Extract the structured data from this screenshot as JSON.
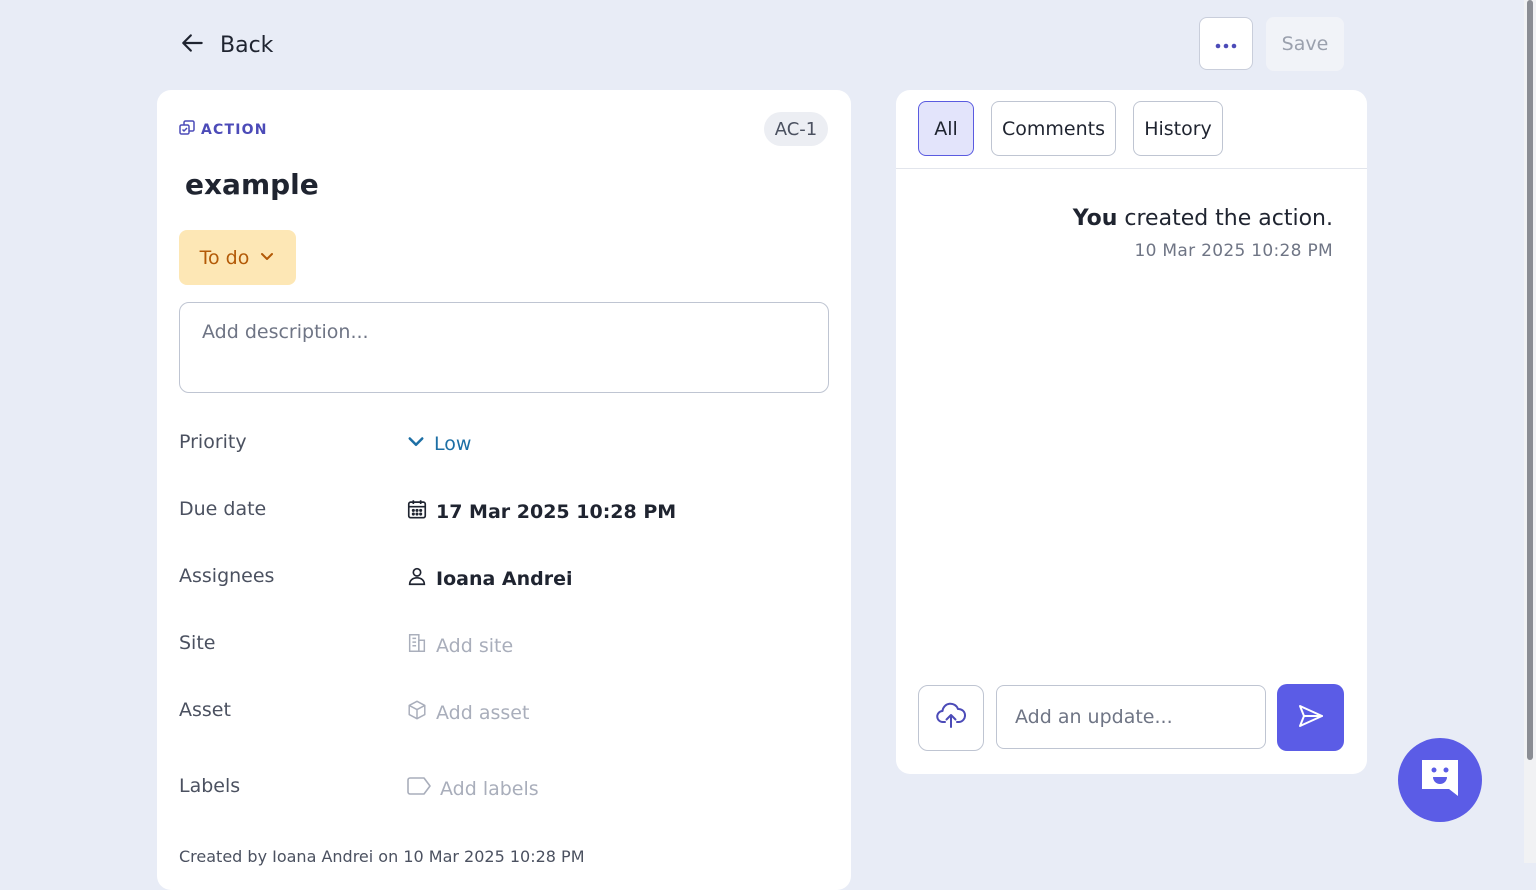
{
  "header": {
    "back_label": "Back",
    "more_label": "···",
    "save_label": "Save"
  },
  "action": {
    "type_label": "ACTION",
    "id": "AC-1",
    "title": "example",
    "status": "To do",
    "description_placeholder": "Add description...",
    "fields": {
      "priority": {
        "label": "Priority",
        "value": "Low"
      },
      "due_date": {
        "label": "Due date",
        "value": "17 Mar 2025 10:28 PM"
      },
      "assignees": {
        "label": "Assignees",
        "value": "Ioana Andrei"
      },
      "site": {
        "label": "Site",
        "value": "Add site"
      },
      "asset": {
        "label": "Asset",
        "value": "Add asset"
      },
      "labels": {
        "label": "Labels",
        "value": "Add labels"
      }
    },
    "created_note": "Created by Ioana Andrei on 10 Mar 2025 10:28 PM"
  },
  "activity_panel": {
    "tabs": [
      {
        "label": "All",
        "active": true
      },
      {
        "label": "Comments",
        "active": false
      },
      {
        "label": "History",
        "active": false
      }
    ],
    "entries": [
      {
        "actor": "You",
        "text": "created the action.",
        "timestamp": "10 Mar 2025 10:28 PM"
      }
    ],
    "update_placeholder": "Add an update..."
  },
  "colors": {
    "accent": "#5b5ce6",
    "status_bg": "#fde7b5",
    "status_text": "#b35a07",
    "priority_text": "#1d6fa5",
    "page_bg": "#e8ecf6"
  },
  "icons": [
    "arrow-left-icon",
    "ellipsis-icon",
    "action-icon",
    "chevron-down-icon",
    "calendar-icon",
    "user-icon",
    "building-icon",
    "cube-icon",
    "tag-icon",
    "cloud-upload-icon",
    "send-icon",
    "chat-bot-icon"
  ]
}
